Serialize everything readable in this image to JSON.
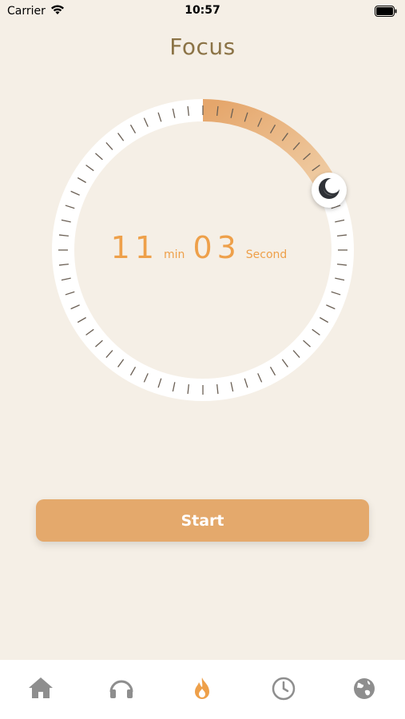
{
  "status_bar": {
    "carrier": "Carrier",
    "time": "10:57",
    "icons": [
      "wifi-icon",
      "battery-icon"
    ]
  },
  "header": {
    "title": "Focus"
  },
  "timer": {
    "minutes": "11",
    "min_label": "min",
    "seconds": "03",
    "second_label": "Second",
    "progress_fraction": 0.18,
    "knob_icon": "moon-icon"
  },
  "actions": {
    "start_label": "Start"
  },
  "tab_bar": {
    "items": [
      {
        "name": "home",
        "icon": "home-icon",
        "active": false
      },
      {
        "name": "sounds",
        "icon": "headphones-icon",
        "active": false
      },
      {
        "name": "focus",
        "icon": "flame-icon",
        "active": true
      },
      {
        "name": "history",
        "icon": "clock-icon",
        "active": false
      },
      {
        "name": "explore",
        "icon": "globe-icon",
        "active": false
      }
    ]
  },
  "colors": {
    "background": "#f5efe6",
    "accent": "#eea04a",
    "button": "#e4a96c",
    "title": "#8b7346",
    "tab_inactive": "#8e8e8e"
  }
}
